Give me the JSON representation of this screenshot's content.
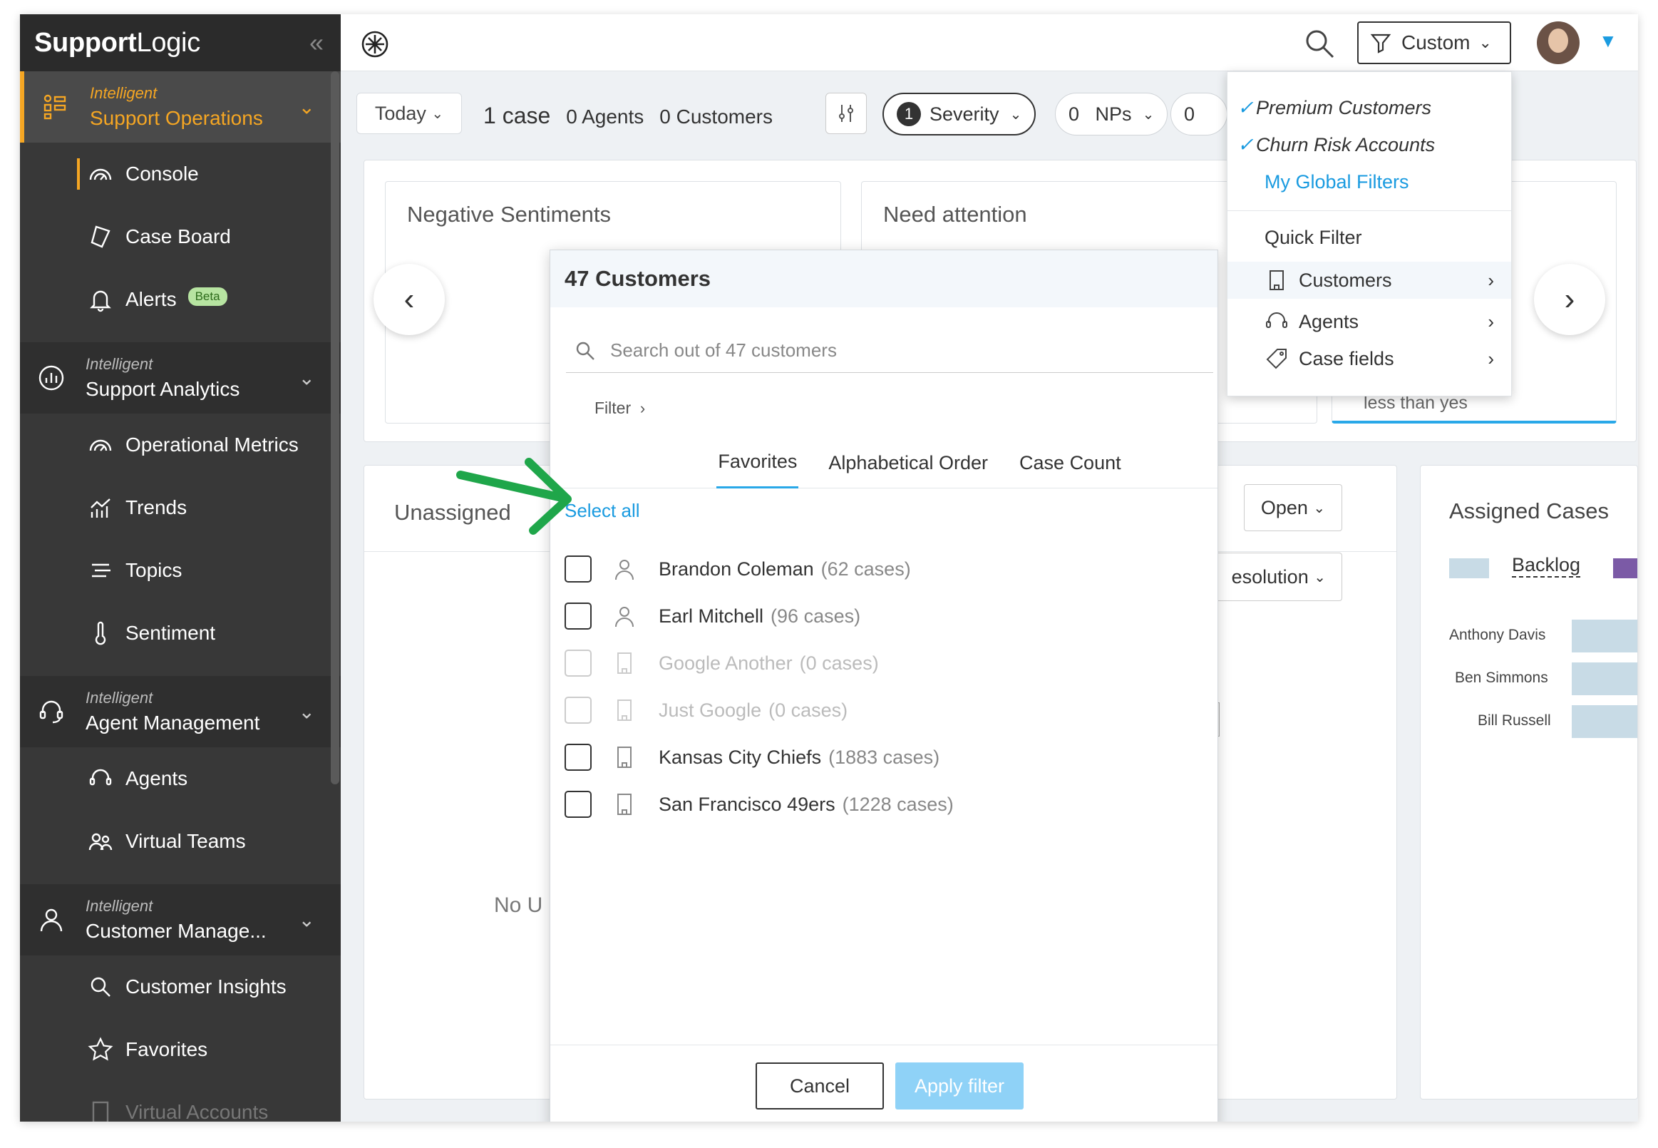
{
  "brand": {
    "strong": "Support",
    "light": "Logic"
  },
  "sidebar": {
    "sections": [
      {
        "sub": "Intelligent",
        "main": "Support Operations",
        "icon": "operations-icon",
        "items": [
          {
            "label": "Console",
            "icon": "gauge-icon"
          },
          {
            "label": "Case Board",
            "icon": "case-board-icon"
          },
          {
            "label": "Alerts",
            "icon": "bell-icon",
            "badge": "Beta"
          }
        ]
      },
      {
        "sub": "Intelligent",
        "main": "Support Analytics",
        "icon": "analytics-icon",
        "items": [
          {
            "label": "Operational Metrics",
            "icon": "gauge-icon"
          },
          {
            "label": "Trends",
            "icon": "trends-icon"
          },
          {
            "label": "Topics",
            "icon": "topics-icon"
          },
          {
            "label": "Sentiment",
            "icon": "thermometer-icon"
          }
        ]
      },
      {
        "sub": "Intelligent",
        "main": "Agent Management",
        "icon": "headset-icon",
        "items": [
          {
            "label": "Agents",
            "icon": "headset-icon"
          },
          {
            "label": "Virtual Teams",
            "icon": "teams-icon"
          }
        ]
      },
      {
        "sub": "Intelligent",
        "main": "Customer Manage...",
        "icon": "person-icon",
        "items": [
          {
            "label": "Customer Insights",
            "icon": "search-icon"
          },
          {
            "label": "Favorites",
            "icon": "star-icon"
          },
          {
            "label": "Virtual Accounts",
            "icon": "building-icon"
          }
        ]
      }
    ]
  },
  "topbar": {
    "custom_label": "Custom"
  },
  "filterbar": {
    "today": "Today",
    "case_count": "1",
    "case_word": "case",
    "agents": "0 Agents",
    "customers": "0 Customers",
    "severity_count": "1",
    "severity_label": "Severity",
    "nps_count": "0",
    "nps_label": "NPs",
    "third_count": "0"
  },
  "cards": {
    "negative": "Negative Sentiments",
    "attention": "Need attention",
    "unassigned": "Unassigned",
    "no_text": "No U",
    "open": "Open",
    "resolution": "esolution",
    "assigned": "Assigned Cases",
    "backlog": "Backlog",
    "less_than": "less than yes",
    "assigned_rows": [
      "Anthony Davis",
      "Ben Simmons",
      "Bill Russell"
    ]
  },
  "modal": {
    "title": "47 Customers",
    "search_placeholder": "Search out of 47 customers",
    "filter_label": "Filter",
    "tabs": [
      "Favorites",
      "Alphabetical Order",
      "Case Count"
    ],
    "select_all": "Select all",
    "rows": [
      {
        "name": "Brandon Coleman",
        "cases": "(62 cases)",
        "type": "person",
        "disabled": false
      },
      {
        "name": "Earl Mitchell",
        "cases": "(96 cases)",
        "type": "person",
        "disabled": false
      },
      {
        "name": "Google Another",
        "cases": "(0 cases)",
        "type": "building",
        "disabled": true
      },
      {
        "name": "Just Google",
        "cases": "(0 cases)",
        "type": "building",
        "disabled": true
      },
      {
        "name": "Kansas City Chiefs",
        "cases": "(1883 cases)",
        "type": "building",
        "disabled": false
      },
      {
        "name": "San Francisco 49ers",
        "cases": "(1228 cases)",
        "type": "building",
        "disabled": false
      }
    ],
    "cancel": "Cancel",
    "apply": "Apply filter"
  },
  "menu": {
    "saved": [
      "Premium Customers",
      "Churn Risk Accounts"
    ],
    "global": "My Global Filters",
    "quick_filter": "Quick Filter",
    "options": [
      "Customers",
      "Agents",
      "Case fields"
    ]
  },
  "colors": {
    "accent": "#f5a623",
    "link": "#1a9be0",
    "annotation_arrow": "#1fa64a"
  }
}
